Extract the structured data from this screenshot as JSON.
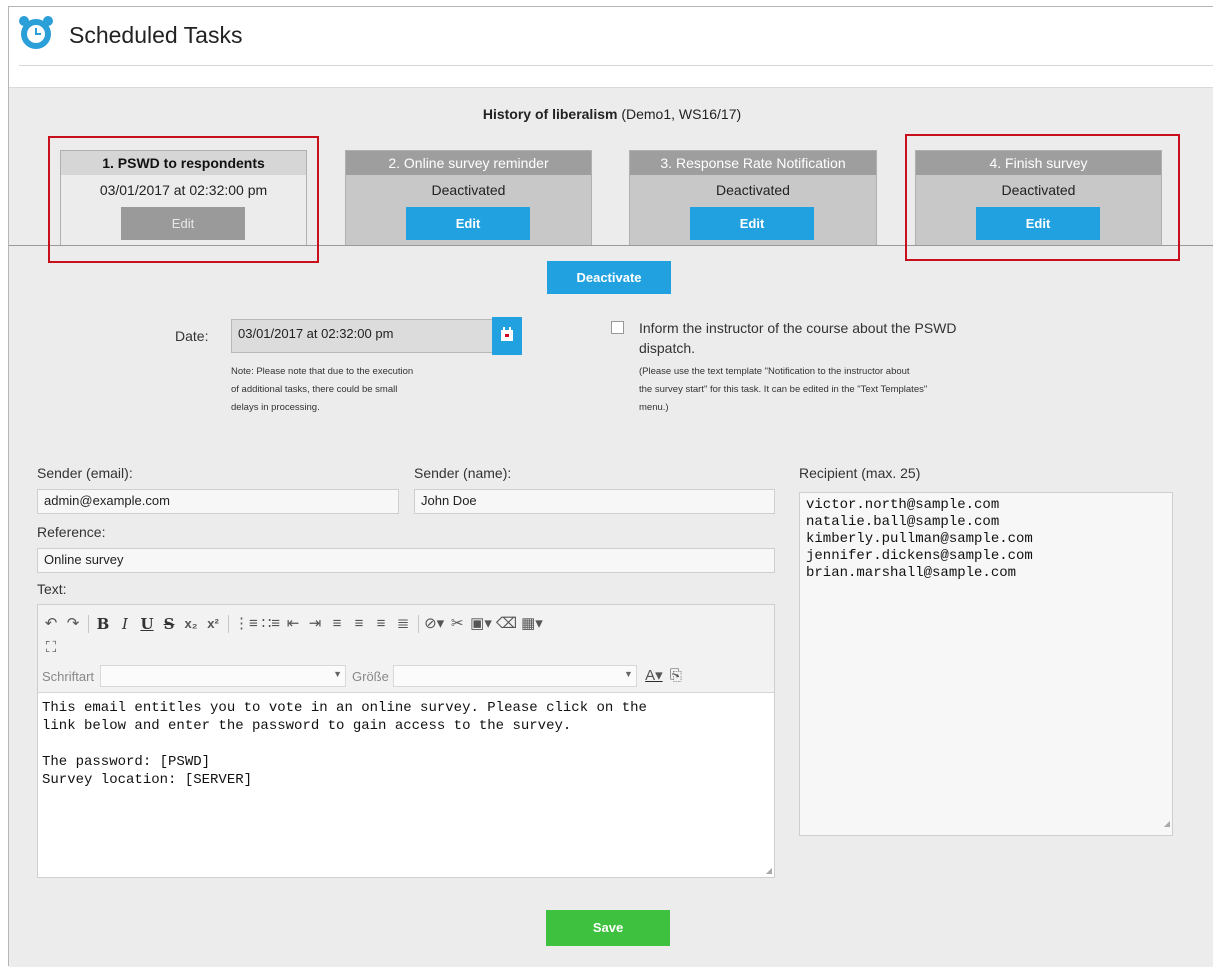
{
  "header": {
    "title": "Scheduled Tasks",
    "icon": "alarm-clock-icon"
  },
  "course": {
    "title": "History of liberalism",
    "details": "(Demo1, WS16/17)"
  },
  "tabs": [
    {
      "label": "1. PSWD to respondents",
      "status": "03/01/2017 at 02:32:00 pm",
      "edit_label": "Edit",
      "active": true,
      "edit_enabled": false
    },
    {
      "label": "2. Online survey reminder",
      "status": "Deactivated",
      "edit_label": "Edit",
      "active": false,
      "edit_enabled": true
    },
    {
      "label": "3. Response Rate Notification",
      "status": "Deactivated",
      "edit_label": "Edit",
      "active": false,
      "edit_enabled": true
    },
    {
      "label": "4. Finish survey",
      "status": "Deactivated",
      "edit_label": "Edit",
      "active": false,
      "edit_enabled": true
    }
  ],
  "deactivate_label": "Deactivate",
  "date": {
    "label": "Date:",
    "value": "03/01/2017 at 02:32:00 pm",
    "note_lines": [
      "Note: Please note that due to the execution",
      "of additional tasks, there could be small",
      "delays in processing."
    ]
  },
  "inform": {
    "checked": false,
    "label_lines": [
      "Inform the instructor of the course about the PSWD",
      "dispatch."
    ],
    "note_lines": [
      "(Please use the text template \"Notification to the instructor about",
      "the survey start\" for this task. It can be edited in the \"Text Templates\"",
      "menu.)"
    ]
  },
  "sender_email": {
    "label": "Sender (email):",
    "value": "admin@example.com"
  },
  "sender_name": {
    "label": "Sender (name):",
    "value": "John Doe"
  },
  "reference": {
    "label": "Reference:",
    "value": "Online survey"
  },
  "text": {
    "label": "Text:",
    "font_label": "Schriftart",
    "size_label": "Größe",
    "body": "This email entitles you to vote in an online survey. Please click on the\nlink below and enter the password to gain access to the survey.\n\nThe password: [PSWD]\nSurvey location: [SERVER]"
  },
  "recipients": {
    "label": "Recipient (max. 25)",
    "list": [
      "victor.north@sample.com",
      "natalie.ball@sample.com",
      "kimberly.pullman@sample.com",
      "jennifer.dickens@sample.com",
      "brian.marshall@sample.com"
    ]
  },
  "save_label": "Save",
  "colors": {
    "accent": "#22a1e0",
    "save": "#3ec13e",
    "highlight": "#c8101c"
  }
}
